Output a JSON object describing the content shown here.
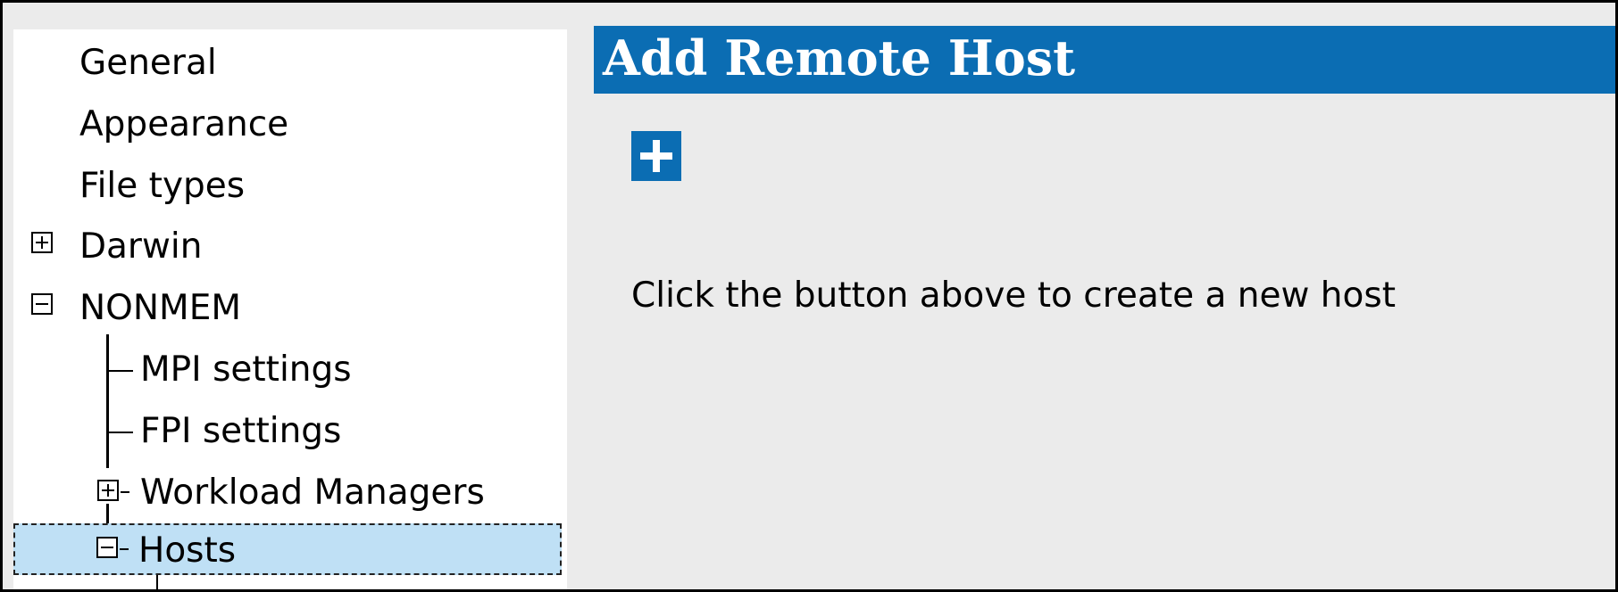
{
  "tree": {
    "items": [
      {
        "label": "General"
      },
      {
        "label": "Appearance"
      },
      {
        "label": "File types"
      },
      {
        "label": "Darwin",
        "expanded": false
      },
      {
        "label": "NONMEM",
        "expanded": true
      },
      {
        "label": "MPI settings"
      },
      {
        "label": "FPI settings"
      },
      {
        "label": "Workload Managers",
        "expanded": false
      },
      {
        "label": "Hosts",
        "expanded": true,
        "selected": true
      }
    ]
  },
  "panel": {
    "title": "Add Remote Host",
    "add_button_icon": "plus-icon",
    "hint": "Click the button above to create a new host"
  },
  "colors": {
    "accent": "#0b6db3",
    "selection": "#bfe0f5",
    "panel_background": "#ebebeb"
  }
}
